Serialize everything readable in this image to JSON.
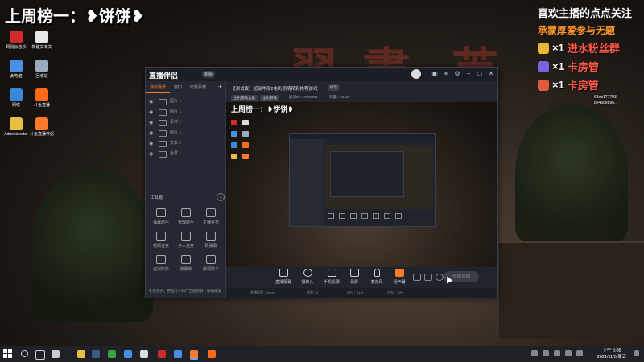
{
  "overlay": {
    "ranking_title": "上周榜一：❥饼饼❥"
  },
  "right_panel": {
    "title": "喜欢主播的点点关注",
    "subtitle": "承蒙厚爱参与无题",
    "rows": [
      {
        "count": "×1",
        "name": "进水粉丝群",
        "color": "#e8b830"
      },
      {
        "count": "×1",
        "name": "卡房管",
        "color": "#7b62e0"
      },
      {
        "count": "×1",
        "name": "卡房管",
        "color": "#e05a3c"
      }
    ]
  },
  "desktop_icons": [
    {
      "label": "网易云音乐",
      "color": "#d02a2a"
    },
    {
      "label": "新建文本文",
      "color": "#e8e8e8"
    },
    {
      "label": "此电脑",
      "color": "#4a90e2"
    },
    {
      "label": "回收站",
      "color": "#9ab"
    },
    {
      "label": "网络",
      "color": "#3a88d8"
    },
    {
      "label": "斗鱼直播",
      "color": "#ff6a1a"
    },
    {
      "label": "Administrator",
      "color": "#e8c040"
    },
    {
      "label": "斗鱼直播伴侣",
      "color": "#ff7a2a"
    }
  ],
  "app": {
    "logo": "直播伴侣",
    "version": "新版",
    "sidebar_tabs": [
      "我的场景",
      "窗口",
      "可放素材"
    ],
    "scenes": [
      "图片 1",
      "图片 1",
      "素材 1",
      "图片 1",
      "文本 2",
      "全屏 1"
    ],
    "tools_label": "工具箱",
    "tools": [
      {
        "label": "弹幕助手"
      },
      {
        "label": "管理助手"
      },
      {
        "label": "主播任务"
      },
      {
        "label": "视频连麦"
      },
      {
        "label": "多人连麦"
      },
      {
        "label": "猜弹幕"
      },
      {
        "label": "虚拟形象"
      },
      {
        "label": "弹幕库"
      },
      {
        "label": "歌词助手"
      }
    ],
    "sidebar_footer": "礼物任务，把图片中的广告图抓取，联通播放",
    "room_title": "【测试版】超级华丽2电影剧情精彩推荐游戏",
    "edit_label": "修改",
    "categories": [
      "主机游戏合集",
      "主机游戏"
    ],
    "stats": [
      "房间ID：7769398",
      "热度：96157"
    ],
    "preview_title": "上周榜一：❥饼饼❥",
    "controls": [
      {
        "label": "直播屏幕"
      },
      {
        "label": "摄像头"
      },
      {
        "label": "手机投屏"
      },
      {
        "label": "录屏"
      },
      {
        "label": "麦克风"
      },
      {
        "label": "扬声器"
      }
    ],
    "go_live": "开始直播",
    "status": [
      "直播码率：0kb/s",
      "帧率：0",
      "CPU：11%",
      "内存：70%"
    ]
  },
  "webcam_overlay": "68eb177793\n8e46deb96...",
  "taskbar": {
    "time": "下午 6:06",
    "date": "2021/11/5 周五"
  }
}
